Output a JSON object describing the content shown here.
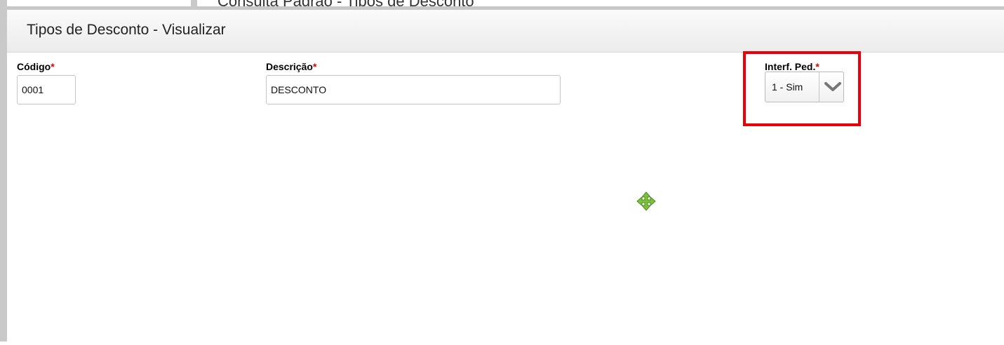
{
  "background": {
    "title": "Consulta Padrão - Tipos de Desconto"
  },
  "modal": {
    "title": "Tipos de Desconto - Visualizar",
    "fields": {
      "codigo": {
        "label": "Código",
        "required_mark": "*",
        "value": "0001"
      },
      "descricao": {
        "label": "Descrição",
        "required_mark": "*",
        "value": "DESCONTO"
      },
      "interf_ped": {
        "label": "Interf. Ped.",
        "required_mark": "*",
        "value": "1 - Sim"
      }
    }
  },
  "icons": {
    "dropdown": "chevron-down-icon",
    "cursor": "move-cursor-icon"
  },
  "colors": {
    "required": "#e00000",
    "highlight": "#e8000b",
    "cursor": "#7cc13a"
  }
}
